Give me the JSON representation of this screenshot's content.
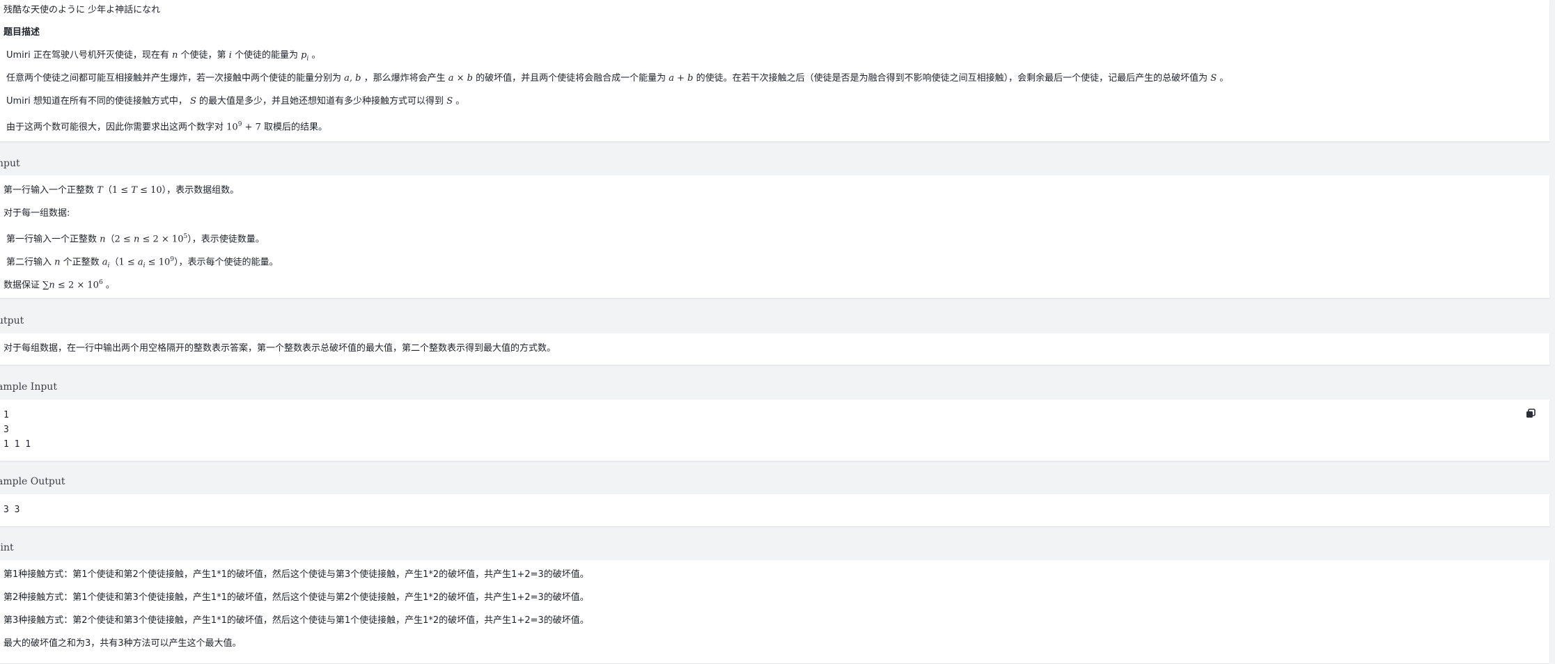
{
  "header": {
    "subtitle": "残酷な天使のように 少年よ神話になれ",
    "desc_heading": "题目描述"
  },
  "description": {
    "p1_a": "Umiri 正在驾驶八号机歼灭使徒，现在有 ",
    "p1_n": "n",
    "p1_b": " 个使徒，第 ",
    "p1_i": "i",
    "p1_c": " 个使徒的能量为 ",
    "p1_p": "p",
    "p1_sub": "i",
    "p1_d": " 。",
    "p2_a": "任意两个使徒之间都可能互相接触并产生爆炸，若一次接触中两个使徒的能量分别为 ",
    "p2_ab": "a, b",
    "p2_b": " ，那么爆炸将会产生 ",
    "p2_axb": "a × b",
    "p2_c": " 的破坏值，并且两个使徒将会融合成一个能量为 ",
    "p2_apb": "a + b",
    "p2_d": " 的使徒。在若干次接触之后（使徒是否是为融合得到不影响使徒之间互相接触），会剩余最后一个使徒，记最后产生的总破坏值为 ",
    "p2_S": "S",
    "p2_e": " 。",
    "p3_a": "Umiri 想知道在所有不同的使徒接触方式中， ",
    "p3_S": "S",
    "p3_b": " 的最大值是多少，并且她还想知道有多少种接触方式可以得到 ",
    "p3_S2": "S",
    "p3_c": " 。",
    "p4_a": "由于这两个数可能很大，因此你需要求出这两个数字对 ",
    "p4_base": "10",
    "p4_exp": "9",
    "p4_plus": " + 7",
    "p4_b": " 取模后的结果。"
  },
  "input": {
    "title": "nput",
    "l1_a": "第一行输入一个正整数 ",
    "l1_T": "T",
    "l1_b": "（",
    "l1_range_a": "1 ≤ ",
    "l1_range_T": "T",
    "l1_range_b": " ≤ 10",
    "l1_c": "），表示数据组数。",
    "l2": "对于每一组数据:",
    "l3_a": "第一行输入一个正整数 ",
    "l3_n": "n",
    "l3_b": "（",
    "l3_range_a": "2 ≤ ",
    "l3_range_n": "n",
    "l3_range_b": " ≤ 2 × 10",
    "l3_range_exp": "5",
    "l3_c": "），表示使徒数量。",
    "l4_a": "第二行输入 ",
    "l4_n": "n",
    "l4_b": " 个正整数 ",
    "l4_a_var": "a",
    "l4_sub": "i",
    "l4_c": "（",
    "l4_range_a": "1 ≤ ",
    "l4_range_var": "a",
    "l4_range_sub": "i",
    "l4_range_b": " ≤ 10",
    "l4_range_exp": "9",
    "l4_d": "），表示每个使徒的能量。",
    "l5_a": "数据保证 ",
    "l5_sum": "∑",
    "l5_n": "n",
    "l5_range": " ≤ 2 × 10",
    "l5_exp": "6",
    "l5_b": " 。"
  },
  "output": {
    "title": "utput",
    "l1": "对于每组数据，在一行中输出两个用空格隔开的整数表示答案，第一个整数表示总破坏值的最大值，第二个整数表示得到最大值的方式数。"
  },
  "sample_input": {
    "title": "ample Input",
    "content": "1\n3\n1 1 1",
    "copy_icon": "copy-icon"
  },
  "sample_output": {
    "title": "ample Output",
    "content": "3 3"
  },
  "hint": {
    "title": "lint",
    "lines": [
      "第1种接触方式：第1个使徒和第2个使徒接触，产生1*1的破坏值，然后这个使徒与第3个使徒接触，产生1*2的破坏值，共产生1+2=3的破坏值。",
      "第2种接触方式：第1个使徒和第3个使徒接触，产生1*1的破坏值，然后这个使徒与第2个使徒接触，产生1*2的破坏值，共产生1+2=3的破坏值。",
      "第3种接触方式：第2个使徒和第3个使徒接触，产生1*1的破坏值，然后这个使徒与第1个使徒接触，产生1*2的破坏值，共产生1+2=3的破坏值。",
      "最大的破坏值之和为3，共有3种方法可以产生这个最大值。"
    ]
  }
}
